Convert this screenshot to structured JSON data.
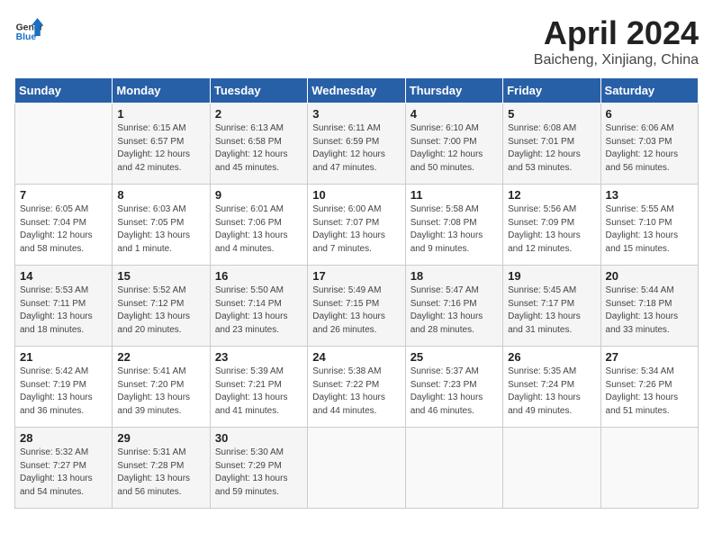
{
  "header": {
    "logo_general": "General",
    "logo_blue": "Blue",
    "month": "April 2024",
    "location": "Baicheng, Xinjiang, China"
  },
  "weekdays": [
    "Sunday",
    "Monday",
    "Tuesday",
    "Wednesday",
    "Thursday",
    "Friday",
    "Saturday"
  ],
  "weeks": [
    [
      {
        "day": "",
        "info": ""
      },
      {
        "day": "1",
        "info": "Sunrise: 6:15 AM\nSunset: 6:57 PM\nDaylight: 12 hours\nand 42 minutes."
      },
      {
        "day": "2",
        "info": "Sunrise: 6:13 AM\nSunset: 6:58 PM\nDaylight: 12 hours\nand 45 minutes."
      },
      {
        "day": "3",
        "info": "Sunrise: 6:11 AM\nSunset: 6:59 PM\nDaylight: 12 hours\nand 47 minutes."
      },
      {
        "day": "4",
        "info": "Sunrise: 6:10 AM\nSunset: 7:00 PM\nDaylight: 12 hours\nand 50 minutes."
      },
      {
        "day": "5",
        "info": "Sunrise: 6:08 AM\nSunset: 7:01 PM\nDaylight: 12 hours\nand 53 minutes."
      },
      {
        "day": "6",
        "info": "Sunrise: 6:06 AM\nSunset: 7:03 PM\nDaylight: 12 hours\nand 56 minutes."
      }
    ],
    [
      {
        "day": "7",
        "info": "Sunrise: 6:05 AM\nSunset: 7:04 PM\nDaylight: 12 hours\nand 58 minutes."
      },
      {
        "day": "8",
        "info": "Sunrise: 6:03 AM\nSunset: 7:05 PM\nDaylight: 13 hours\nand 1 minute."
      },
      {
        "day": "9",
        "info": "Sunrise: 6:01 AM\nSunset: 7:06 PM\nDaylight: 13 hours\nand 4 minutes."
      },
      {
        "day": "10",
        "info": "Sunrise: 6:00 AM\nSunset: 7:07 PM\nDaylight: 13 hours\nand 7 minutes."
      },
      {
        "day": "11",
        "info": "Sunrise: 5:58 AM\nSunset: 7:08 PM\nDaylight: 13 hours\nand 9 minutes."
      },
      {
        "day": "12",
        "info": "Sunrise: 5:56 AM\nSunset: 7:09 PM\nDaylight: 13 hours\nand 12 minutes."
      },
      {
        "day": "13",
        "info": "Sunrise: 5:55 AM\nSunset: 7:10 PM\nDaylight: 13 hours\nand 15 minutes."
      }
    ],
    [
      {
        "day": "14",
        "info": "Sunrise: 5:53 AM\nSunset: 7:11 PM\nDaylight: 13 hours\nand 18 minutes."
      },
      {
        "day": "15",
        "info": "Sunrise: 5:52 AM\nSunset: 7:12 PM\nDaylight: 13 hours\nand 20 minutes."
      },
      {
        "day": "16",
        "info": "Sunrise: 5:50 AM\nSunset: 7:14 PM\nDaylight: 13 hours\nand 23 minutes."
      },
      {
        "day": "17",
        "info": "Sunrise: 5:49 AM\nSunset: 7:15 PM\nDaylight: 13 hours\nand 26 minutes."
      },
      {
        "day": "18",
        "info": "Sunrise: 5:47 AM\nSunset: 7:16 PM\nDaylight: 13 hours\nand 28 minutes."
      },
      {
        "day": "19",
        "info": "Sunrise: 5:45 AM\nSunset: 7:17 PM\nDaylight: 13 hours\nand 31 minutes."
      },
      {
        "day": "20",
        "info": "Sunrise: 5:44 AM\nSunset: 7:18 PM\nDaylight: 13 hours\nand 33 minutes."
      }
    ],
    [
      {
        "day": "21",
        "info": "Sunrise: 5:42 AM\nSunset: 7:19 PM\nDaylight: 13 hours\nand 36 minutes."
      },
      {
        "day": "22",
        "info": "Sunrise: 5:41 AM\nSunset: 7:20 PM\nDaylight: 13 hours\nand 39 minutes."
      },
      {
        "day": "23",
        "info": "Sunrise: 5:39 AM\nSunset: 7:21 PM\nDaylight: 13 hours\nand 41 minutes."
      },
      {
        "day": "24",
        "info": "Sunrise: 5:38 AM\nSunset: 7:22 PM\nDaylight: 13 hours\nand 44 minutes."
      },
      {
        "day": "25",
        "info": "Sunrise: 5:37 AM\nSunset: 7:23 PM\nDaylight: 13 hours\nand 46 minutes."
      },
      {
        "day": "26",
        "info": "Sunrise: 5:35 AM\nSunset: 7:24 PM\nDaylight: 13 hours\nand 49 minutes."
      },
      {
        "day": "27",
        "info": "Sunrise: 5:34 AM\nSunset: 7:26 PM\nDaylight: 13 hours\nand 51 minutes."
      }
    ],
    [
      {
        "day": "28",
        "info": "Sunrise: 5:32 AM\nSunset: 7:27 PM\nDaylight: 13 hours\nand 54 minutes."
      },
      {
        "day": "29",
        "info": "Sunrise: 5:31 AM\nSunset: 7:28 PM\nDaylight: 13 hours\nand 56 minutes."
      },
      {
        "day": "30",
        "info": "Sunrise: 5:30 AM\nSunset: 7:29 PM\nDaylight: 13 hours\nand 59 minutes."
      },
      {
        "day": "",
        "info": ""
      },
      {
        "day": "",
        "info": ""
      },
      {
        "day": "",
        "info": ""
      },
      {
        "day": "",
        "info": ""
      }
    ]
  ]
}
